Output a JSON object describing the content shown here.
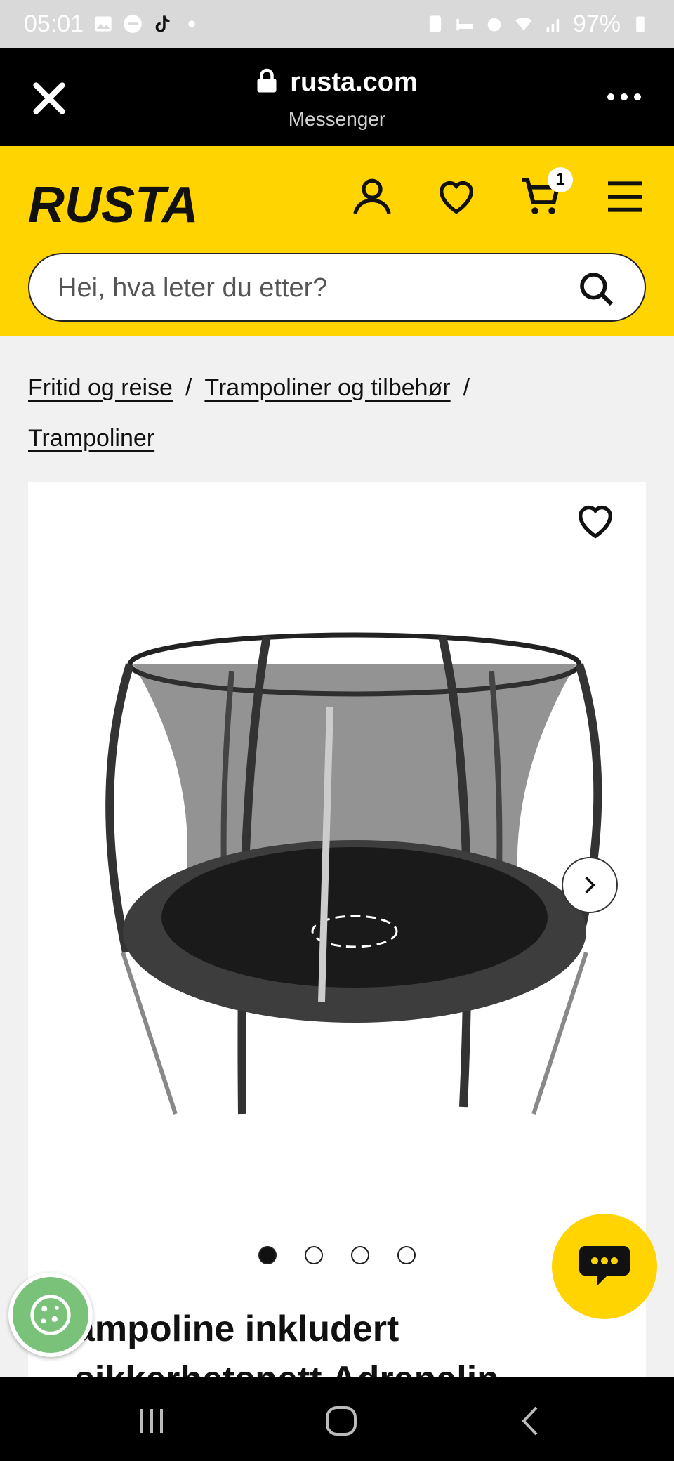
{
  "status_bar": {
    "time": "05:01",
    "battery": "97%"
  },
  "browser": {
    "url": "rusta.com",
    "subtitle": "Messenger"
  },
  "header": {
    "logo_text": "RUSTA",
    "cart_count": "1",
    "search_placeholder": "Hei, hva leter du etter?"
  },
  "breadcrumb": {
    "items": [
      "Fritid og reise",
      "Trampoliner og tilbehør",
      "Trampoliner"
    ],
    "separator": "/"
  },
  "product": {
    "title_line1": "ampoline inkludert",
    "title_line2": "sikkerhetsnett Adrenalin",
    "image_count": 4,
    "active_image": 0
  },
  "colors": {
    "brand_yellow": "#ffd400",
    "browser_bar": "#000000",
    "cookie_green": "#7ac27a"
  }
}
